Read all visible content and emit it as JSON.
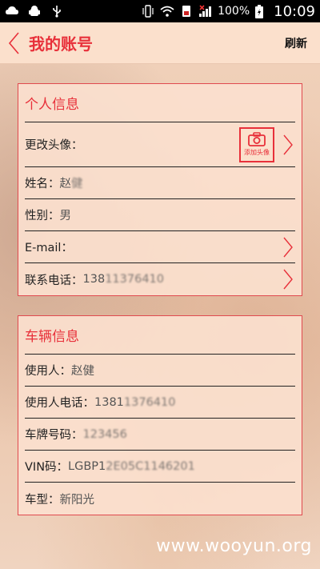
{
  "status_bar": {
    "battery_pct": "100%",
    "time": "10:09"
  },
  "header": {
    "title": "我的账号",
    "refresh_label": "刷新"
  },
  "personal_info": {
    "title": "个人信息",
    "avatar_label": "更改头像：",
    "avatar_button_caption": "添加头像",
    "name_label": "姓名：",
    "name_value": "赵",
    "name_value_blurred": "健",
    "gender_label": "性别：",
    "gender_value": "男",
    "email_label": "E-mail：",
    "phone_label": "联系电话：",
    "phone_value": "138",
    "phone_value_blurred": "11376410"
  },
  "vehicle_info": {
    "title": "车辆信息",
    "user_label": "使用人：",
    "user_value": "赵健",
    "user_phone_label": "使用人电话：",
    "user_phone_value": "1381",
    "user_phone_value_blurred": "1376410",
    "plate_label": "车牌号码：",
    "plate_value_blurred": "123456",
    "vin_label": "VIN码：",
    "vin_value": "LGBP1",
    "vin_value_blurred": "2E05C1146201",
    "model_label": "车型：",
    "model_value": "新阳光"
  },
  "watermark": "www.wooyun.org",
  "colors": {
    "accent": "#e8303a",
    "background": "#efcdb4",
    "header_bg": "#fbe0cc"
  }
}
